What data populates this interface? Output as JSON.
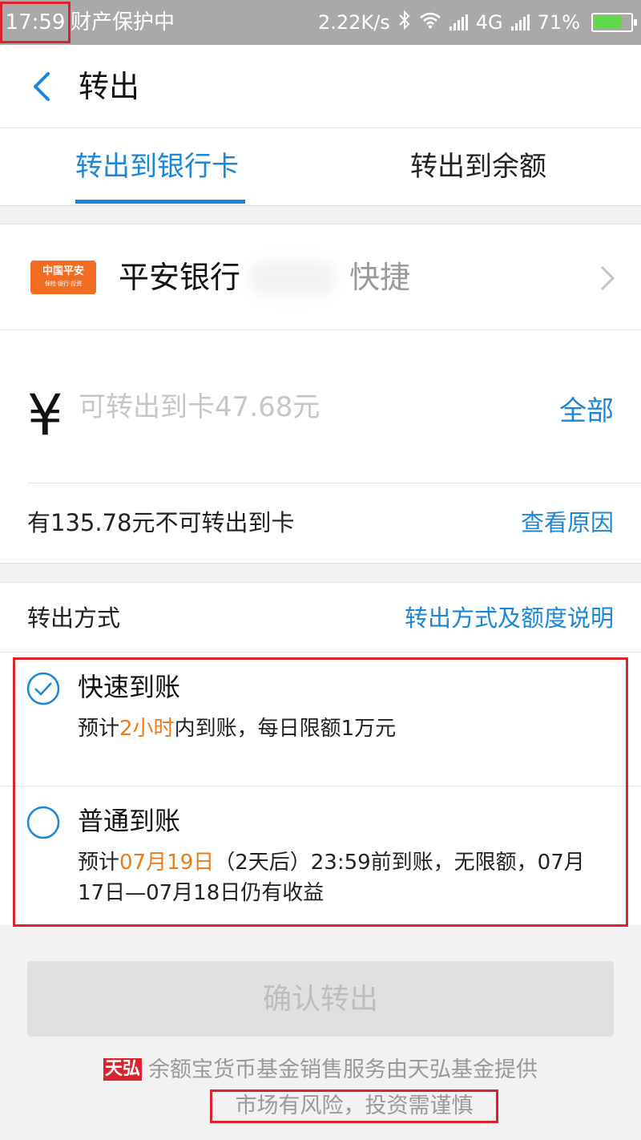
{
  "status_bar": {
    "time": "17:59",
    "notice": "财产保护中",
    "speed": "2.22K/s",
    "network": "4G",
    "battery": "71%"
  },
  "header": {
    "title": "转出",
    "back_icon": "chevron-left-icon"
  },
  "tabs": [
    {
      "label": "转出到银行卡",
      "active": true
    },
    {
      "label": "转出到余额",
      "active": false
    }
  ],
  "bank": {
    "logo_text": "中国平安",
    "logo_sub": "保险·银行·投资",
    "name": "平安银行",
    "type": "快捷"
  },
  "amount": {
    "currency_symbol": "¥",
    "placeholder": "可转出到卡47.68元",
    "all_label": "全部",
    "unavailable_text": "有135.78元不可转出到卡",
    "reason_label": "查看原因"
  },
  "method": {
    "label": "转出方式",
    "link_label": "转出方式及额度说明",
    "options": [
      {
        "title": "快速到账",
        "selected": true,
        "desc_prefix": "预计",
        "desc_highlight": "2小时",
        "desc_suffix": "内到账，每日限额1万元"
      },
      {
        "title": "普通到账",
        "selected": false,
        "desc_prefix": "预计",
        "desc_highlight": "07月19日",
        "desc_suffix": "（2天后）23:59前到账，无限额，07月17日—07月18日仍有收益"
      }
    ]
  },
  "confirm_label": "确认转出",
  "footer": {
    "logo_text": "天弘",
    "service_text": "余额宝货币基金销售服务由天弘基金提供",
    "risk_text": "市场有风险，投资需谨慎"
  },
  "colors": {
    "accent": "#1a86d8",
    "highlight": "#ef7a1a",
    "annotation_red": "#d9232d",
    "status_bar": "#a9a9a9"
  }
}
